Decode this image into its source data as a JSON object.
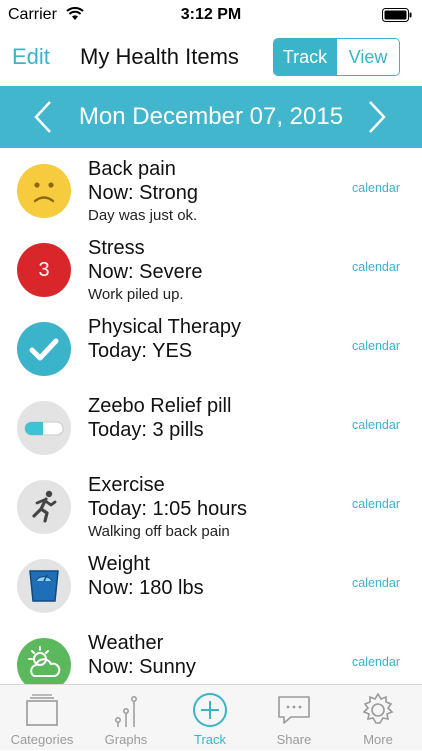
{
  "status_bar": {
    "carrier": "Carrier",
    "time": "3:12 PM"
  },
  "nav": {
    "edit_label": "Edit",
    "title": "My Health Items",
    "segments": [
      "Track",
      "View"
    ],
    "active_segment": "Track"
  },
  "date_bar": {
    "date": "Mon December 07, 2015",
    "accent": "#42b6cc"
  },
  "items": [
    {
      "name": "Back pain",
      "status": "Now: Strong",
      "note": "Day was just ok.",
      "link": "calendar",
      "icon": "sad-face-icon",
      "color": "#f6cc3e"
    },
    {
      "name": "Stress",
      "status": "Now: Severe",
      "note": "Work piled up.",
      "link": "calendar",
      "icon": "severity-badge-icon",
      "badge": "3",
      "color": "#d9262b"
    },
    {
      "name": "Physical Therapy",
      "status": "Today: YES",
      "note": "",
      "link": "calendar",
      "icon": "checkmark-icon",
      "color": "#3bb3c8"
    },
    {
      "name": "Zeebo Relief pill",
      "status": "Today: 3 pills",
      "note": "",
      "link": "calendar",
      "icon": "pill-icon",
      "color": "#e3e3e3"
    },
    {
      "name": "Exercise",
      "status": "Today: 1:05 hours",
      "note": "Walking off back pain",
      "link": "calendar",
      "icon": "running-person-icon",
      "color": "#e3e3e3"
    },
    {
      "name": "Weight",
      "status": "Now: 180 lbs",
      "note": "",
      "link": "calendar",
      "icon": "scale-icon",
      "color": "#e3e3e3"
    },
    {
      "name": "Weather",
      "status": "Now: Sunny",
      "note": "",
      "link": "calendar",
      "icon": "sun-cloud-icon",
      "color": "#5cb85c"
    }
  ],
  "tabs": [
    {
      "label": "Categories",
      "icon": "categories-icon"
    },
    {
      "label": "Graphs",
      "icon": "graphs-icon"
    },
    {
      "label": "Track",
      "icon": "plus-circle-icon",
      "active": true
    },
    {
      "label": "Share",
      "icon": "chat-bubble-icon"
    },
    {
      "label": "More",
      "icon": "gear-icon"
    }
  ]
}
